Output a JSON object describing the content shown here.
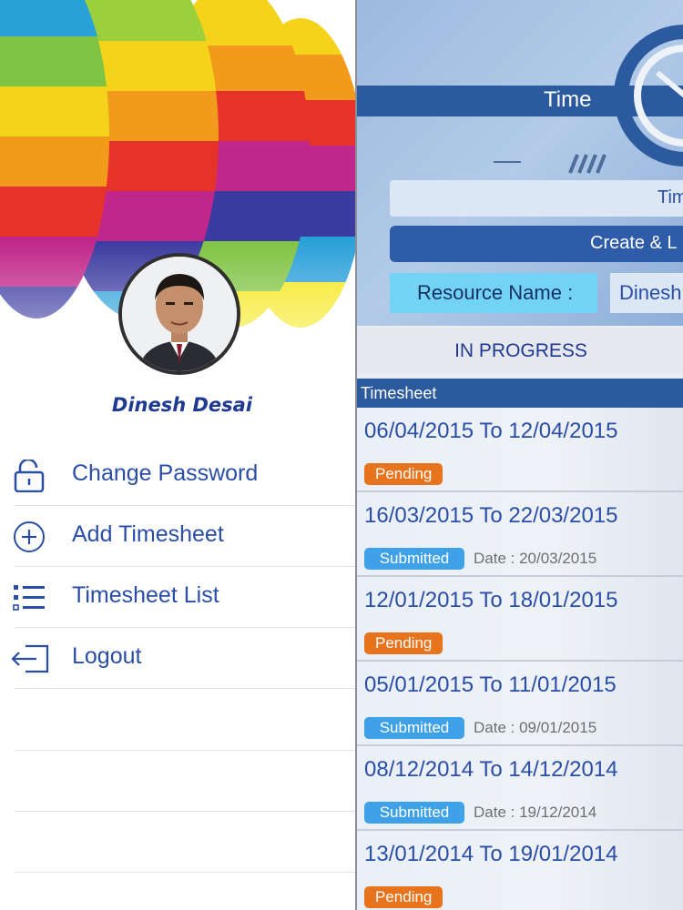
{
  "drawer": {
    "user_name": "Dinesh Desai",
    "menu": [
      {
        "label": "Change Password",
        "icon": "unlock-icon"
      },
      {
        "label": "Add Timesheet",
        "icon": "plus-circle-icon"
      },
      {
        "label": "Timesheet List",
        "icon": "list-icon"
      },
      {
        "label": "Logout",
        "icon": "logout-icon"
      }
    ]
  },
  "main": {
    "title": "Time",
    "buttons": {
      "timesheet": "Times",
      "create": "Create & L"
    },
    "resource": {
      "label": "Resource Name :",
      "value": "Dinesh"
    },
    "tab": "IN PROGRESS",
    "list_header": "Timesheet",
    "timesheets": [
      {
        "range": "06/04/2015 To 12/04/2015",
        "status": "Pending",
        "date": ""
      },
      {
        "range": "16/03/2015 To 22/03/2015",
        "status": "Submitted",
        "date": "Date : 20/03/2015"
      },
      {
        "range": "12/01/2015 To 18/01/2015",
        "status": "Pending",
        "date": ""
      },
      {
        "range": "05/01/2015 To 11/01/2015",
        "status": "Submitted",
        "date": "Date : 09/01/2015"
      },
      {
        "range": "08/12/2014 To 14/12/2014",
        "status": "Submitted",
        "date": "Date : 19/12/2014"
      },
      {
        "range": "13/01/2014 To 19/01/2014",
        "status": "Pending",
        "date": ""
      }
    ]
  },
  "colors": {
    "brand_blue": "#2a4ea8",
    "pending": "#e8731d",
    "submitted": "#3fa1e8",
    "header_bar": "#2c5a9e"
  }
}
